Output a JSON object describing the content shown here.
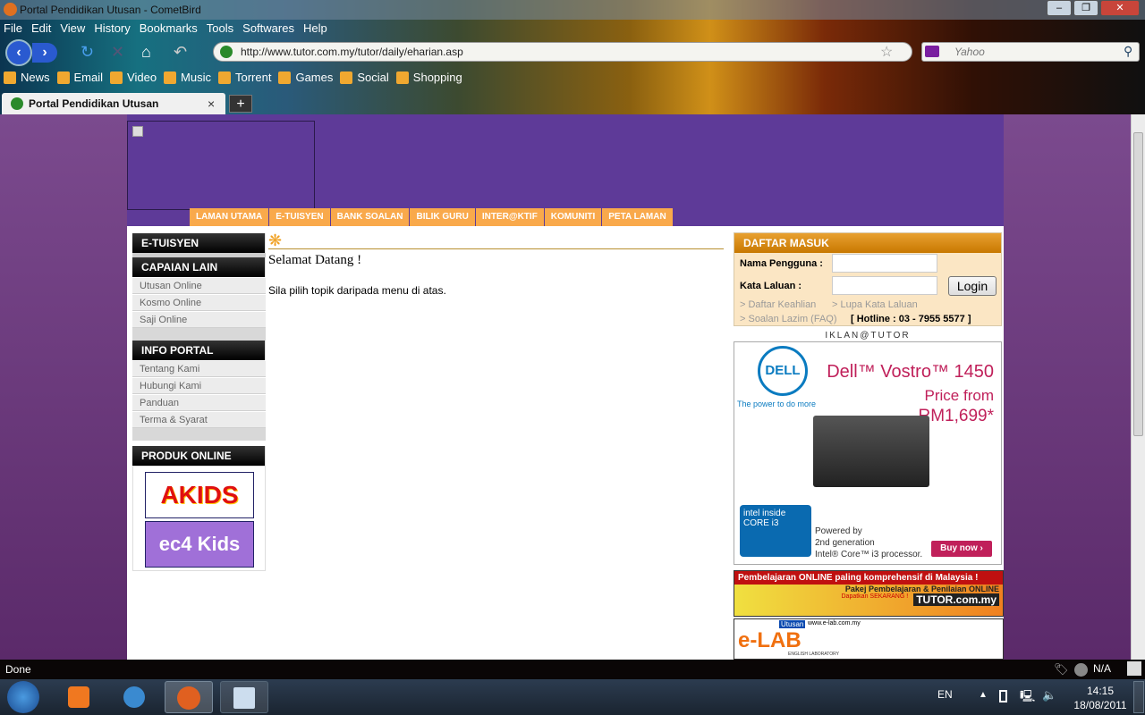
{
  "window": {
    "title": "Portal Pendidikan Utusan - CometBird"
  },
  "menu": [
    "File",
    "Edit",
    "View",
    "History",
    "Bookmarks",
    "Tools",
    "Softwares",
    "Help"
  ],
  "address": {
    "url": "http://www.tutor.com.my/tutor/daily/eharian.asp"
  },
  "search": {
    "placeholder": "Yahoo"
  },
  "bookmarks": [
    "News",
    "Email",
    "Video",
    "Music",
    "Torrent",
    "Games",
    "Social",
    "Shopping"
  ],
  "tab": {
    "label": "Portal Pendidikan Utusan",
    "new_tab": "+",
    "close": "×"
  },
  "mainnav": [
    "LAMAN UTAMA",
    "E-TUISYEN",
    "BANK SOALAN",
    "BILIK GURU",
    "INTER@KTIF",
    "KOMUNITI",
    "PETA LAMAN"
  ],
  "sidebar": {
    "etuisyen": "E-TUISYEN",
    "capaian": {
      "title": "CAPAIAN LAIN",
      "items": [
        "Utusan Online",
        "Kosmo Online",
        "Saji Online"
      ]
    },
    "info": {
      "title": "INFO PORTAL",
      "items": [
        "Tentang Kami",
        "Hubungi Kami",
        "Panduan",
        "Terma & Syarat"
      ]
    },
    "produk": {
      "title": "PRODUK ONLINE",
      "items": [
        "AKIDS",
        "ec4 Kids"
      ]
    }
  },
  "main": {
    "heading": "Selamat Datang !",
    "text": "Sila pilih topik daripada menu di atas."
  },
  "login": {
    "title": "DAFTAR MASUK",
    "username_label": "Nama Pengguna :",
    "username_value": "",
    "password_label": "Kata Laluan :",
    "password_value": "",
    "button": "Login",
    "register": "> Daftar Keahlian",
    "forgot": "> Lupa Kata Laluan",
    "faq": "> Soalan Lazim (FAQ)",
    "hotline": "[ Hotline : 03 - 7955 5577 ]"
  },
  "ads": {
    "label": "IKLAN@TUTOR",
    "dell": {
      "brand": "DELL",
      "tagline": "The power to do more",
      "product": "Dell™ Vostro™ 1450",
      "price_label": "Price from",
      "price": "RM1,699*",
      "intel": "intel inside CORE i3",
      "powered": "Powered by",
      "gen": "2nd generation",
      "processor": "Intel® Core™ i3 processor.",
      "buy": "Buy now ›"
    },
    "tutor_banner": {
      "line1": "Pembelajaran ONLINE paling komprehensif di Malaysia !",
      "line2": "Pakej Pembelajaran & Penilaian ONLINE",
      "cta": "Dapatkan SEKARANG !",
      "site": "TUTOR.com.my"
    },
    "elab_banner": {
      "brand": "Utusan",
      "site": "www.e-lab.com.my",
      "name": "e-LAB",
      "sub": "ENGLISH LABORATORY"
    }
  },
  "status": {
    "text": "Done",
    "na": "N/A"
  },
  "taskbar": {
    "lang": "EN",
    "time": "14:15",
    "date": "18/08/2011"
  }
}
